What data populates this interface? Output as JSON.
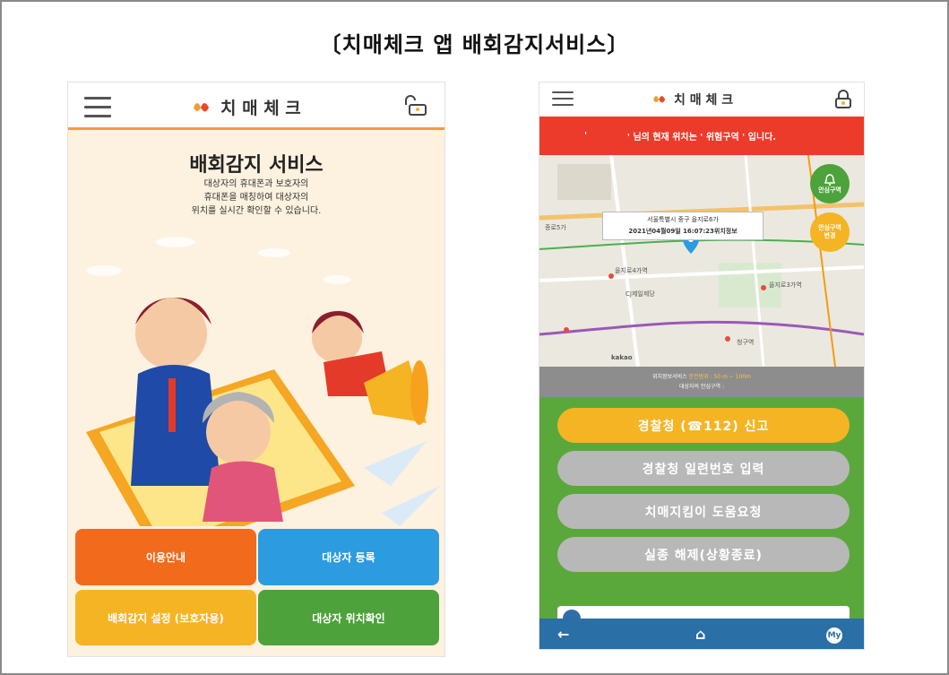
{
  "page": {
    "title": "〔치매체크 앱 배회감지서비스〕"
  },
  "left_phone": {
    "app_name": "치 매 체 크",
    "service_title": "배회감지 서비스",
    "service_desc": [
      "대상자의 휴대폰과 보호자의",
      "휴대폰을 매칭하여 대상자의",
      "위치를 실시간 확인할 수 있습니다."
    ],
    "buttons": {
      "usage_guide": "이용안내",
      "register_target": "대상자 등록",
      "wander_settings": "배회감지 설정 (보호자용)",
      "target_location": "대상자 위치확인"
    }
  },
  "right_phone": {
    "app_name": "치 매 체 크",
    "alert_text": "' 님의 현재 위치는 ' 위험구역 ' 입니다.",
    "alert_dot": "'",
    "map": {
      "popup_address": "서울특별시 중구 을지로6가",
      "popup_info": "2021년04월09일 16:07:23위치정보",
      "safe_zone": [
        "안심구역"
      ],
      "safe_zone_change": [
        "안심구역",
        "변경"
      ],
      "labels": [
        "을지로4가역",
        "CJ제일제당",
        "을지로3가역",
        "종로5가",
        "청구역",
        "kakao"
      ]
    },
    "info": {
      "line1_prefix": "위치정보서비스 ",
      "line1_highlight": "안전범위 : 50 m ~ 100m",
      "line2": "대상자의 안심구역 :"
    },
    "buttons": {
      "police_report": "경찰청 (☎112) 신고",
      "police_serial": "경찰청 일련번호 입력",
      "dementia_help": "치매지킴이 도움요청",
      "missing_release": "실종 해제(상황종료)"
    },
    "nav": {
      "back": "←",
      "home": "⌂",
      "my": "My"
    }
  },
  "colors": {
    "orange": "#f26a1b",
    "blue": "#2c9be0",
    "yellow": "#f5b423",
    "green": "#4da23b",
    "alert_red": "#ec3b2a",
    "nav_blue": "#2a6fa5"
  }
}
